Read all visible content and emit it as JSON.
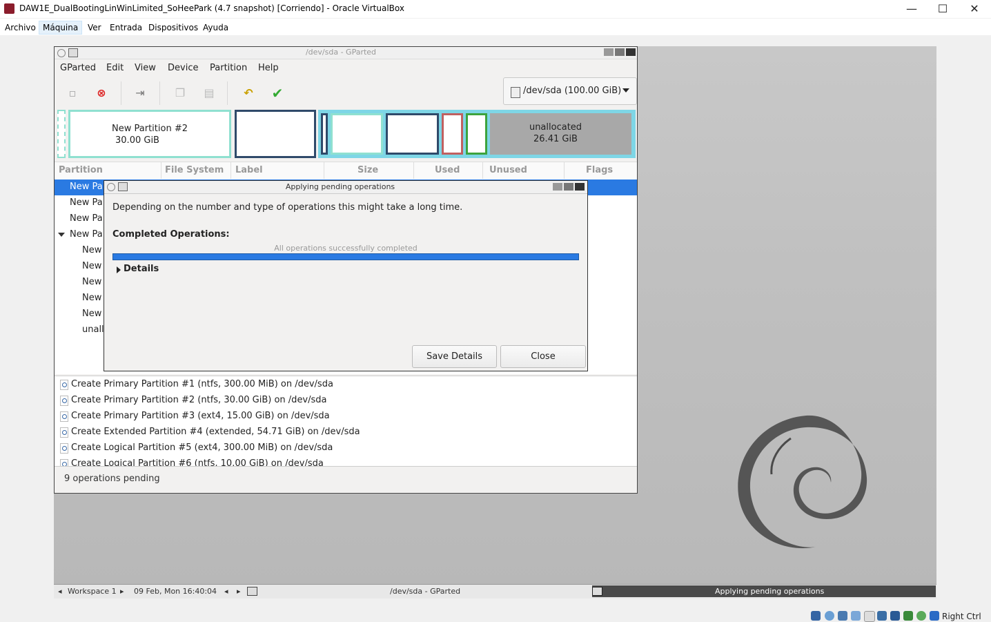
{
  "vbox": {
    "title": "DAW1E_DualBootingLinWinLimited_SoHeePark (4.7 snapshot) [Corriendo] - Oracle VirtualBox",
    "menu": [
      "Archivo",
      "Máquina",
      "Ver",
      "Entrada",
      "Dispositivos",
      "Ayuda"
    ],
    "window_controls": {
      "minimize": "—",
      "maximize": "☐",
      "close": "✕"
    },
    "host_key": "Right Ctrl"
  },
  "gparted": {
    "title": "/dev/sda - GParted",
    "menu": [
      "GParted",
      "Edit",
      "View",
      "Device",
      "Partition",
      "Help"
    ],
    "device": "/dev/sda  (100.00 GiB)",
    "map": {
      "p2_name": "New Partition #2",
      "p2_size": "30.00 GiB",
      "unalloc_name": "unallocated",
      "unalloc_size": "26.41 GiB"
    },
    "columns": [
      "Partition",
      "File System",
      "Label",
      "Size",
      "Used",
      "Unused",
      "Flags"
    ],
    "rows": [
      "New Pa",
      "New Pa",
      "New Pa",
      "New Pa",
      "New",
      "New",
      "New",
      "New",
      "New",
      "unall"
    ],
    "operations": [
      "Create Primary Partition #1 (ntfs, 300.00 MiB) on /dev/sda",
      "Create Primary Partition #2 (ntfs, 30.00 GiB) on /dev/sda",
      "Create Primary Partition #3 (ext4, 15.00 GiB) on /dev/sda",
      "Create Extended Partition #4 (extended, 54.71 GiB) on /dev/sda",
      "Create Logical Partition #5 (ext4, 300.00 MiB) on /dev/sda",
      "Create Logical Partition #6 (ntfs, 10.00 GiB) on /dev/sda"
    ],
    "status": "9 operations pending"
  },
  "dialog": {
    "title": "Applying pending operations",
    "description": "Depending on the number and type of operations this might take a long time.",
    "completed_label": "Completed Operations:",
    "progress_text": "All operations successfully completed",
    "progress_fraction": 1.0,
    "details_label": "Details",
    "save_button": "Save Details",
    "close_button": "Close"
  },
  "taskbar": {
    "workspace": "Workspace 1",
    "clock": "09 Feb, Mon 16:40:04",
    "task1": "/dev/sda - GParted",
    "task2": "Applying pending operations"
  },
  "colors": {
    "selection": "#2a7ae2",
    "partition_ntfs": "#8fe0d0",
    "partition_ext4": "#2f4a6a",
    "partition_extended": "#7ed6e6",
    "partition_red": "#c06060",
    "partition_green": "#3da33d",
    "unallocated": "#a8a8a8"
  }
}
